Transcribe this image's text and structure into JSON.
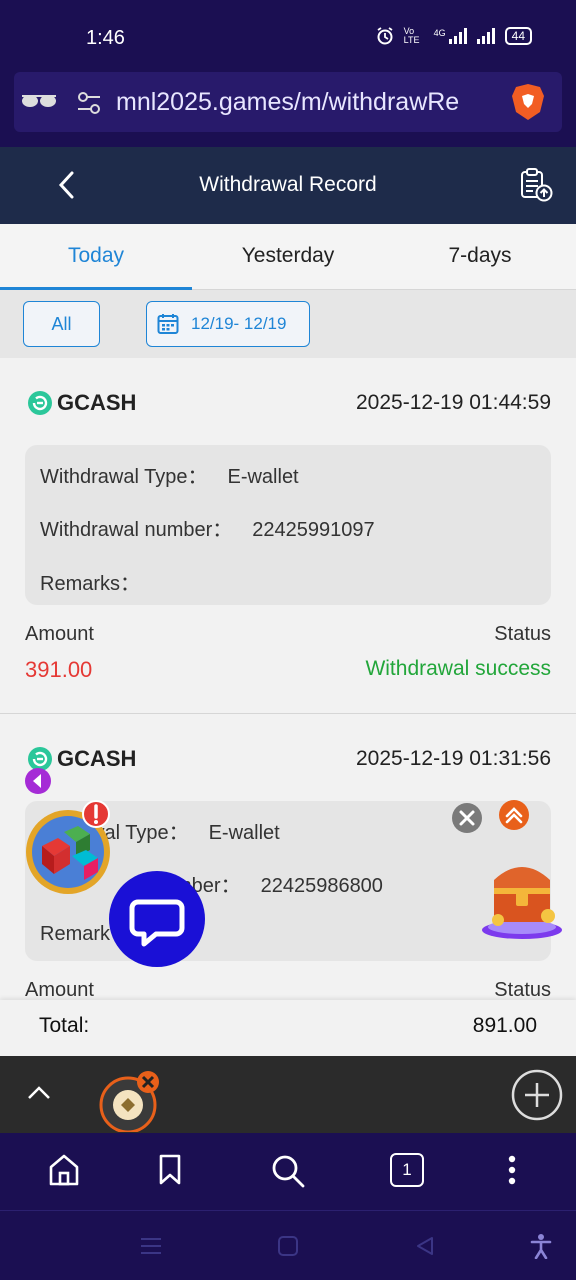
{
  "status_bar": {
    "time": "1:46",
    "network": "Vo LTE",
    "network2": "4G",
    "battery": "44"
  },
  "browser": {
    "url": "mnl2025.games/m/withdrawRe"
  },
  "header": {
    "title": "Withdrawal Record"
  },
  "tabs": [
    {
      "label": "Today"
    },
    {
      "label": "Yesterday"
    },
    {
      "label": "7-days"
    }
  ],
  "filters": {
    "all_label": "All",
    "date_range": "12/19- 12/19"
  },
  "records": [
    {
      "channel": "GCASH",
      "time": "2025-12-19 01:44:59",
      "type_label": "Withdrawal Type：",
      "type_value": "E-wallet",
      "number_label": "Withdrawal number：",
      "number_value": "22425991097",
      "remarks_label": "Remarks：",
      "amount_label": "Amount",
      "amount": "391.00",
      "status_label": "Status",
      "status": "Withdrawal success"
    },
    {
      "channel": "GCASH",
      "time": "2025-12-19 01:31:56",
      "type_label": "wal Type：",
      "type_value": "E-wallet",
      "number_label": "mber：",
      "number_value": "22425986800",
      "remarks_label": "Remark",
      "amount_label": "Amount",
      "status_label": "Status"
    }
  ],
  "total": {
    "label": "Total:",
    "value": "891.00"
  },
  "tab_strip": {
    "tab_count": "1"
  },
  "colors": {
    "accent": "#1f85d6",
    "amount": "#e53935",
    "success": "#22a63a",
    "header_bg": "#1e2b4a",
    "browser_bg": "#1b0f52"
  }
}
